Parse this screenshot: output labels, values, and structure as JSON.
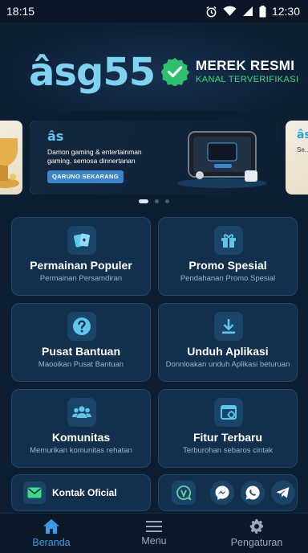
{
  "status_bar": {
    "time": "18:15",
    "right_time": "12:30",
    "icons": [
      "alarm-icon",
      "wifi-icon",
      "signal-icon",
      "battery-icon"
    ]
  },
  "hero": {
    "logo_text": "âsg55",
    "verified_title": "MEREK RESMI",
    "verified_subtitle": "KANAL TERVERIFIKASI",
    "verified_color": "#3ddc84"
  },
  "carousel": {
    "slide": {
      "logo": "âs",
      "description": "Damon gaming & entertainman gaming, semosa dinnertanan",
      "cta": "QARUNO SEKARANG"
    },
    "right_peek": {
      "logo": "âs",
      "text": "Se... m..."
    },
    "page_count": 3,
    "active_page": 0
  },
  "cards": [
    {
      "title": "Permainan Populer",
      "subtitle": "Permainan Persamdiran",
      "icon": "cards-icon"
    },
    {
      "title": "Promo Spesial",
      "subtitle": "Pendahanan Promo Spesial",
      "icon": "gift-icon"
    },
    {
      "title": "Pusat Bantuan",
      "subtitle": "Maooikan Pusat Bantuan",
      "icon": "help-icon"
    },
    {
      "title": "Unduh Aplikasi",
      "subtitle": "Donnloakan unduh Aplikasi beturuan",
      "icon": "download-icon"
    },
    {
      "title": "Komunitas",
      "subtitle": "Memurikan komunitas rehatan",
      "icon": "community-icon"
    },
    {
      "title": "Fitur Terbaru",
      "subtitle": "Terburohan sebaros cintak",
      "icon": "new-feature-icon"
    }
  ],
  "contact": {
    "label": "Kontak Oficial",
    "icon": "mail-icon"
  },
  "social": [
    "vip-chat-icon",
    "messenger-icon",
    "whatsapp-icon",
    "telegram-icon"
  ],
  "bottom_nav": [
    {
      "label": "Beranda",
      "icon": "home-icon",
      "active": true
    },
    {
      "label": "Menu",
      "icon": "menu-icon",
      "active": false
    },
    {
      "label": "Pengaturan",
      "icon": "gear-icon",
      "active": false
    }
  ],
  "colors": {
    "background": "#0d1e33",
    "card": "#12304d",
    "card_border": "#22476b",
    "accent": "#3b9be6",
    "icon": "#5fc6ec"
  }
}
